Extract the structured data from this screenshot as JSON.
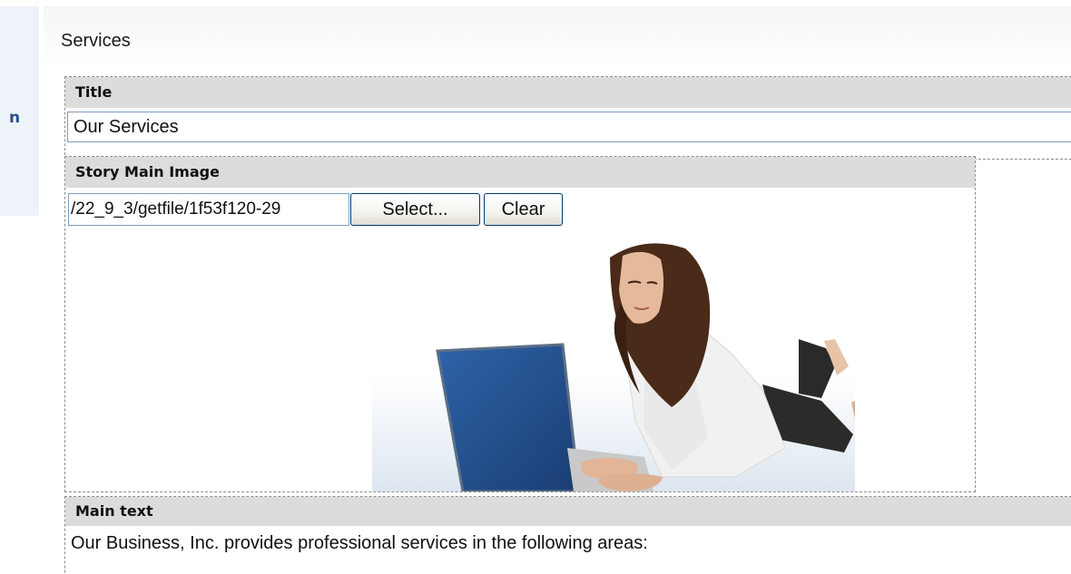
{
  "page": {
    "title": "Services"
  },
  "sidebar": {
    "visible_glyph": "n"
  },
  "fields": {
    "title": {
      "label": "Title",
      "value": "Our Services"
    },
    "main_image": {
      "label": "Story Main Image",
      "path_value": "/22_9_3/getfile/1f53f120-29",
      "select_label": "Select...",
      "clear_label": "Clear"
    },
    "main_text": {
      "label": "Main text",
      "value": "Our Business, Inc. provides professional services in the following areas:"
    }
  },
  "colors": {
    "header_bg": "#dcdcdc",
    "input_border": "#7f9db9",
    "sidebar_bg": "#eef3fa",
    "laptop_blue": "#1f4f8f"
  }
}
